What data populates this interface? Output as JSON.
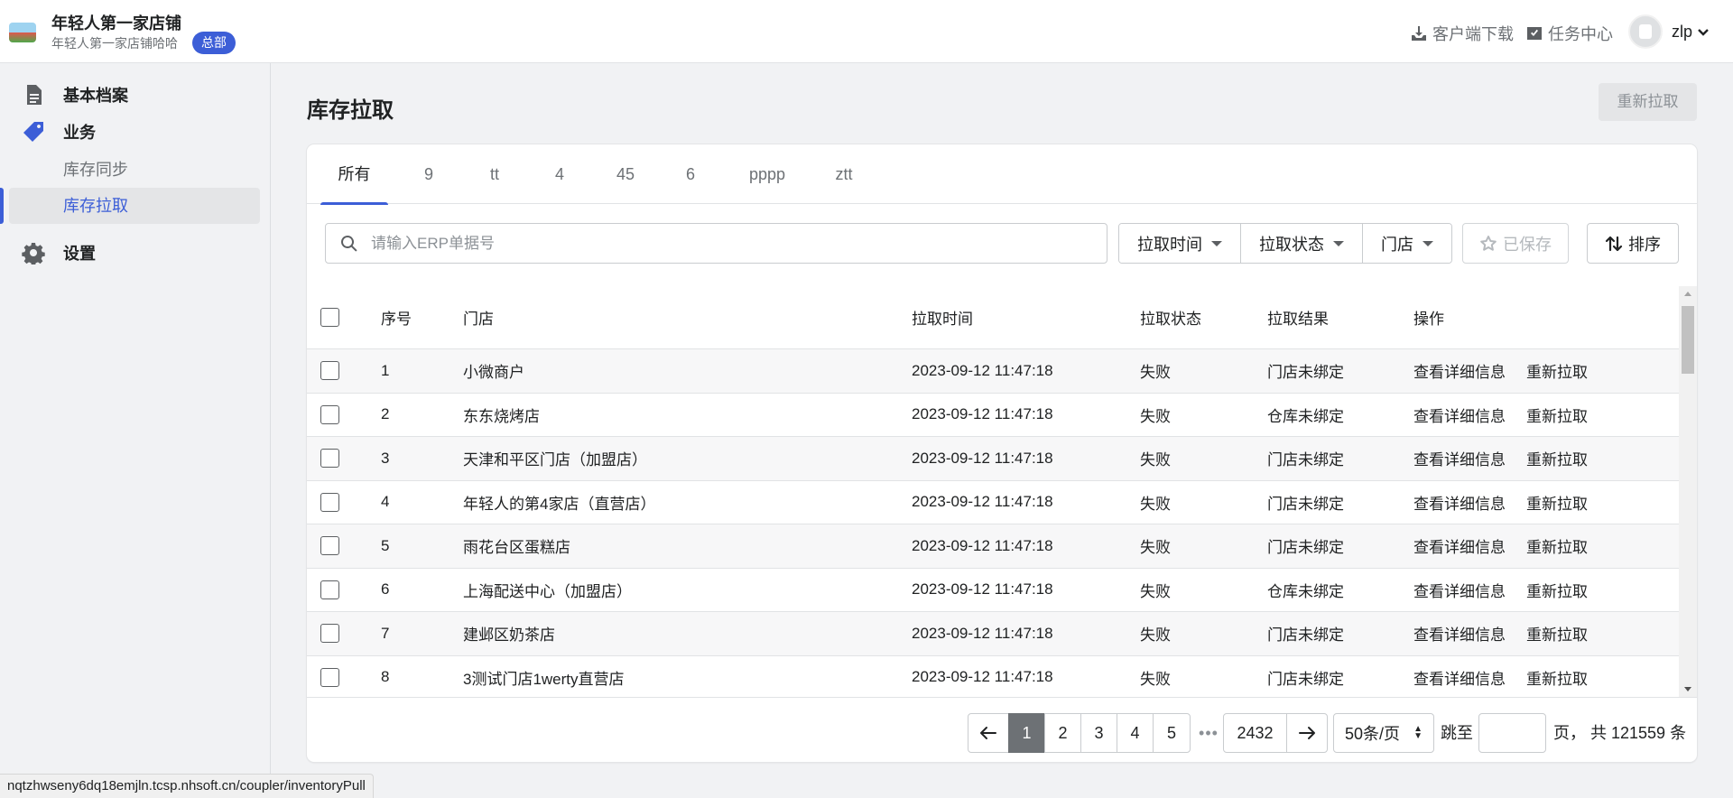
{
  "header": {
    "store_name": "年轻人第一家店铺",
    "store_subtitle": "年轻人第一家店铺哈哈",
    "badge": "总部",
    "download_label": "客户端下载",
    "tasks_label": "任务中心",
    "user_name": "zlp"
  },
  "sidebar": {
    "basic": "基本档案",
    "business": "业务",
    "sub_items": [
      "库存同步",
      "库存拉取"
    ],
    "settings": "设置"
  },
  "page": {
    "title": "库存拉取",
    "repull_button": "重新拉取"
  },
  "tabs": [
    "所有",
    "9",
    "tt",
    "4",
    "45",
    "6",
    "pppp",
    "ztt"
  ],
  "filters": {
    "search_placeholder": "请输入ERP单据号",
    "pull_time": "拉取时间",
    "pull_status": "拉取状态",
    "store": "门店",
    "saved": "已保存",
    "sort": "排序"
  },
  "table": {
    "headers": [
      "序号",
      "门店",
      "拉取时间",
      "拉取状态",
      "拉取结果",
      "操作"
    ],
    "action_view": "查看详细信息",
    "action_repull": "重新拉取",
    "rows": [
      {
        "no": "1",
        "store": "小微商户",
        "time": "2023-09-12 11:47:18",
        "status": "失败",
        "result": "门店未绑定"
      },
      {
        "no": "2",
        "store": "东东烧烤店",
        "time": "2023-09-12 11:47:18",
        "status": "失败",
        "result": "仓库未绑定"
      },
      {
        "no": "3",
        "store": "天津和平区门店（加盟店）",
        "time": "2023-09-12 11:47:18",
        "status": "失败",
        "result": "门店未绑定"
      },
      {
        "no": "4",
        "store": "年轻人的第4家店（直营店）",
        "time": "2023-09-12 11:47:18",
        "status": "失败",
        "result": "门店未绑定"
      },
      {
        "no": "5",
        "store": "雨花台区蛋糕店",
        "time": "2023-09-12 11:47:18",
        "status": "失败",
        "result": "门店未绑定"
      },
      {
        "no": "6",
        "store": "上海配送中心（加盟店）",
        "time": "2023-09-12 11:47:18",
        "status": "失败",
        "result": "仓库未绑定"
      },
      {
        "no": "7",
        "store": "建邺区奶茶店",
        "time": "2023-09-12 11:47:18",
        "status": "失败",
        "result": "门店未绑定"
      },
      {
        "no": "8",
        "store": "3测试门店1werty直营店",
        "time": "2023-09-12 11:47:18",
        "status": "失败",
        "result": "门店未绑定"
      }
    ]
  },
  "pagination": {
    "pages": [
      "1",
      "2",
      "3",
      "4",
      "5"
    ],
    "current": "1",
    "ellipsis": "•••",
    "last": "2432",
    "page_size": "50条/页",
    "jump_label": "跳至",
    "jump_value": "",
    "total_text": "页， 共 121559 条"
  },
  "status_url": "nqtzhwseny6dq18emjln.tcsp.nhsoft.cn/coupler/inventoryPull",
  "colors": {
    "accent": "#3c5ed7",
    "link": "#2c6ecb",
    "active_page": "#6d7175"
  }
}
